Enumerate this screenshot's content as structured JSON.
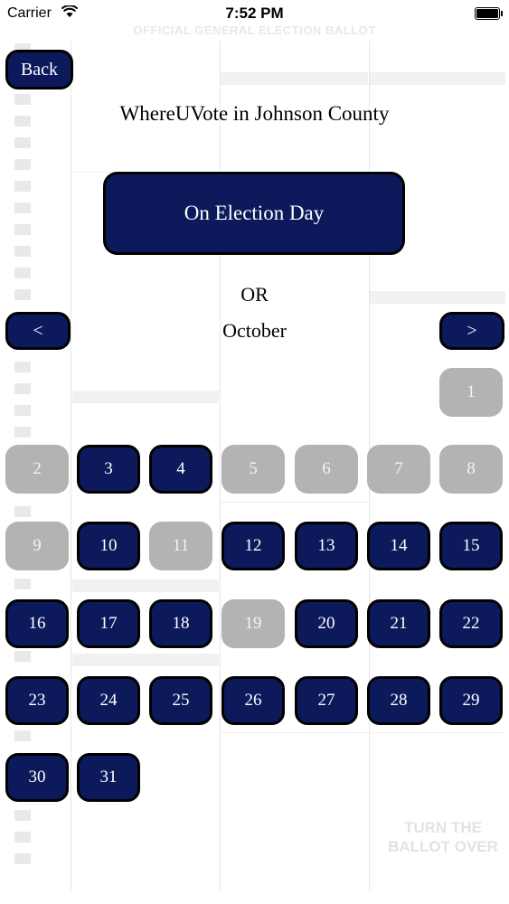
{
  "status_bar": {
    "carrier": "Carrier",
    "time": "7:52 PM"
  },
  "background": {
    "header": "OFFICIAL GENERAL ELECTION BALLOT",
    "turn_over": "TURN THE BALLOT OVER"
  },
  "nav": {
    "back_label": "Back"
  },
  "title": "WhereUVote in Johnson County",
  "election_day_label": "On Election Day",
  "or_label": "OR",
  "month": "October",
  "prev_label": "<",
  "next_label": ">",
  "calendar": {
    "days": [
      {
        "label": "1",
        "available": false
      },
      {
        "label": "2",
        "available": false
      },
      {
        "label": "3",
        "available": true
      },
      {
        "label": "4",
        "available": true
      },
      {
        "label": "5",
        "available": false
      },
      {
        "label": "6",
        "available": false
      },
      {
        "label": "7",
        "available": false
      },
      {
        "label": "8",
        "available": false
      },
      {
        "label": "9",
        "available": false
      },
      {
        "label": "10",
        "available": true
      },
      {
        "label": "11",
        "available": false
      },
      {
        "label": "12",
        "available": true
      },
      {
        "label": "13",
        "available": true
      },
      {
        "label": "14",
        "available": true
      },
      {
        "label": "15",
        "available": true
      },
      {
        "label": "16",
        "available": true
      },
      {
        "label": "17",
        "available": true
      },
      {
        "label": "18",
        "available": true
      },
      {
        "label": "19",
        "available": false
      },
      {
        "label": "20",
        "available": true
      },
      {
        "label": "21",
        "available": true
      },
      {
        "label": "22",
        "available": true
      },
      {
        "label": "23",
        "available": true
      },
      {
        "label": "24",
        "available": true
      },
      {
        "label": "25",
        "available": true
      },
      {
        "label": "26",
        "available": true
      },
      {
        "label": "27",
        "available": true
      },
      {
        "label": "28",
        "available": true
      },
      {
        "label": "29",
        "available": true
      },
      {
        "label": "30",
        "available": true
      },
      {
        "label": "31",
        "available": true
      }
    ]
  },
  "colors": {
    "button_fill": "#0c1a5c",
    "button_border": "#000000",
    "disabled_fill": "#b3b3b3",
    "text_on_button": "#ffffff"
  }
}
